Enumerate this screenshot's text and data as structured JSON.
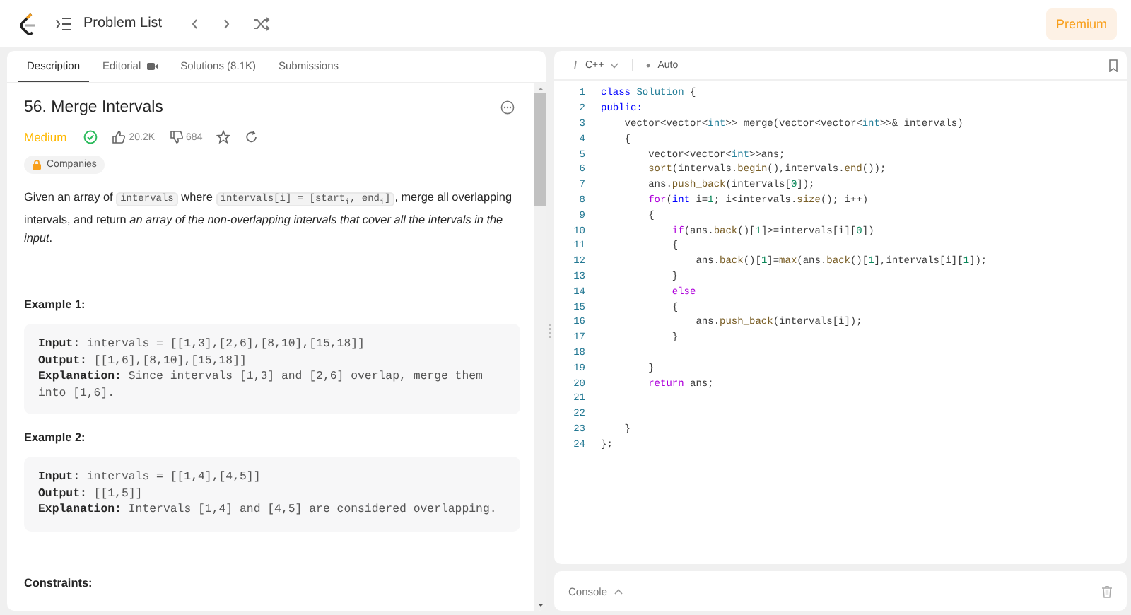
{
  "topbar": {
    "title": "Problem List",
    "premium": "Premium"
  },
  "tabs": [
    {
      "label": "Description",
      "selected": true,
      "video": false
    },
    {
      "label": "Editorial",
      "selected": false,
      "video": true
    },
    {
      "label": "Solutions (8.1K)",
      "selected": false,
      "video": false
    },
    {
      "label": "Submissions",
      "selected": false,
      "video": false
    }
  ],
  "problem": {
    "title": "56. Merge Intervals",
    "difficulty": "Medium",
    "solved": true,
    "likes": "20.2K",
    "dislikes": "684",
    "companies": "Companies",
    "description": [
      {
        "kind": "text",
        "text": "Given an array of "
      },
      {
        "kind": "code",
        "text": "intervals"
      },
      {
        "kind": "text",
        "text": " where "
      },
      {
        "kind": "code",
        "text": "intervals[i] = [start$_{i}$, end$_{i}$]"
      },
      {
        "kind": "text",
        "text": ", merge all overlapping intervals, and return *an array of the non-overlapping intervals that cover all the intervals in the input*."
      }
    ],
    "examples": [
      {
        "heading": "Example 1:",
        "lines": [
          "**Input:** intervals = [[1,3],[2,6],[8,10],[15,18]]",
          "**Output:** [[1,6],[8,10],[15,18]]",
          "**Explanation:** Since intervals [1,3] and [2,6] overlap, merge them into [1,6]."
        ]
      },
      {
        "heading": "Example 2:",
        "lines": [
          "**Input:** intervals = [[1,4],[4,5]]",
          "**Output:** [[1,5]]",
          "**Explanation:** Intervals [1,4] and [4,5] are considered overlapping."
        ]
      }
    ],
    "constraints_heading": "Constraints:"
  },
  "editor": {
    "language": "C++",
    "mode": "Auto",
    "console": "Console",
    "lines": [
      {
        "n": "1",
        "tokens": [
          {
            "kind": "kw",
            "text": "class "
          },
          {
            "kind": "type",
            "text": "Solution"
          },
          {
            "kind": "plain",
            "text": " {"
          }
        ]
      },
      {
        "n": "2",
        "tokens": [
          {
            "kind": "kw",
            "text": "public:"
          }
        ]
      },
      {
        "n": "3",
        "tokens": [
          {
            "kind": "plain",
            "text": "    vector<vector<"
          },
          {
            "kind": "type",
            "text": "int"
          },
          {
            "kind": "plain",
            "text": ">> merge(vector<vector<"
          },
          {
            "kind": "type",
            "text": "int"
          },
          {
            "kind": "plain",
            "text": ">>& intervals)"
          }
        ]
      },
      {
        "n": "4",
        "tokens": [
          {
            "kind": "plain",
            "text": "    {"
          }
        ]
      },
      {
        "n": "5",
        "tokens": [
          {
            "kind": "plain",
            "text": "        vector<vector<"
          },
          {
            "kind": "type",
            "text": "int"
          },
          {
            "kind": "plain",
            "text": ">>ans;"
          }
        ]
      },
      {
        "n": "6",
        "tokens": [
          {
            "kind": "fn",
            "text": "        sort"
          },
          {
            "kind": "plain",
            "text": "(intervals."
          },
          {
            "kind": "fn",
            "text": "begin"
          },
          {
            "kind": "plain",
            "text": "(),intervals."
          },
          {
            "kind": "fn",
            "text": "end"
          },
          {
            "kind": "plain",
            "text": "());"
          }
        ]
      },
      {
        "n": "7",
        "tokens": [
          {
            "kind": "plain",
            "text": "        ans."
          },
          {
            "kind": "fn",
            "text": "push_back"
          },
          {
            "kind": "plain",
            "text": "(intervals["
          },
          {
            "kind": "num",
            "text": "0"
          },
          {
            "kind": "plain",
            "text": "]);"
          }
        ]
      },
      {
        "n": "8",
        "tokens": [
          {
            "kind": "ctrl",
            "text": "        for"
          },
          {
            "kind": "plain",
            "text": "("
          },
          {
            "kind": "kw",
            "text": "int"
          },
          {
            "kind": "plain",
            "text": " i="
          },
          {
            "kind": "num",
            "text": "1"
          },
          {
            "kind": "plain",
            "text": "; i<intervals."
          },
          {
            "kind": "fn",
            "text": "size"
          },
          {
            "kind": "plain",
            "text": "(); i++)"
          }
        ]
      },
      {
        "n": "9",
        "tokens": [
          {
            "kind": "plain",
            "text": "        {"
          }
        ]
      },
      {
        "n": "10",
        "tokens": [
          {
            "kind": "ctrl",
            "text": "            if"
          },
          {
            "kind": "plain",
            "text": "(ans."
          },
          {
            "kind": "fn",
            "text": "back"
          },
          {
            "kind": "plain",
            "text": "()["
          },
          {
            "kind": "num",
            "text": "1"
          },
          {
            "kind": "plain",
            "text": "]>=intervals[i]["
          },
          {
            "kind": "num",
            "text": "0"
          },
          {
            "kind": "plain",
            "text": "])"
          }
        ]
      },
      {
        "n": "11",
        "tokens": [
          {
            "kind": "plain",
            "text": "            {"
          }
        ]
      },
      {
        "n": "12",
        "tokens": [
          {
            "kind": "plain",
            "text": "                ans."
          },
          {
            "kind": "fn",
            "text": "back"
          },
          {
            "kind": "plain",
            "text": "()["
          },
          {
            "kind": "num",
            "text": "1"
          },
          {
            "kind": "plain",
            "text": "]="
          },
          {
            "kind": "fn",
            "text": "max"
          },
          {
            "kind": "plain",
            "text": "(ans."
          },
          {
            "kind": "fn",
            "text": "back"
          },
          {
            "kind": "plain",
            "text": "()["
          },
          {
            "kind": "num",
            "text": "1"
          },
          {
            "kind": "plain",
            "text": "],intervals[i]["
          },
          {
            "kind": "num",
            "text": "1"
          },
          {
            "kind": "plain",
            "text": "]);"
          }
        ]
      },
      {
        "n": "13",
        "tokens": [
          {
            "kind": "plain",
            "text": "            }"
          }
        ]
      },
      {
        "n": "14",
        "tokens": [
          {
            "kind": "ctrl",
            "text": "            else"
          }
        ]
      },
      {
        "n": "15",
        "tokens": [
          {
            "kind": "plain",
            "text": "            {"
          }
        ]
      },
      {
        "n": "16",
        "tokens": [
          {
            "kind": "plain",
            "text": "                ans."
          },
          {
            "kind": "fn",
            "text": "push_back"
          },
          {
            "kind": "plain",
            "text": "(intervals[i]);"
          }
        ]
      },
      {
        "n": "17",
        "tokens": [
          {
            "kind": "plain",
            "text": "            }"
          }
        ]
      },
      {
        "n": "18"
      },
      {
        "n": "19",
        "tokens": [
          {
            "kind": "plain",
            "text": "        }"
          }
        ]
      },
      {
        "n": "20",
        "tokens": [
          {
            "kind": "ctrl",
            "text": "        return"
          },
          {
            "kind": "plain",
            "text": " ans;"
          }
        ]
      },
      {
        "n": "21"
      },
      {
        "n": "22"
      },
      {
        "n": "23",
        "tokens": [
          {
            "kind": "plain",
            "text": "    }"
          }
        ]
      },
      {
        "n": "24",
        "tokens": [
          {
            "kind": "plain",
            "text": "};"
          }
        ]
      }
    ]
  }
}
